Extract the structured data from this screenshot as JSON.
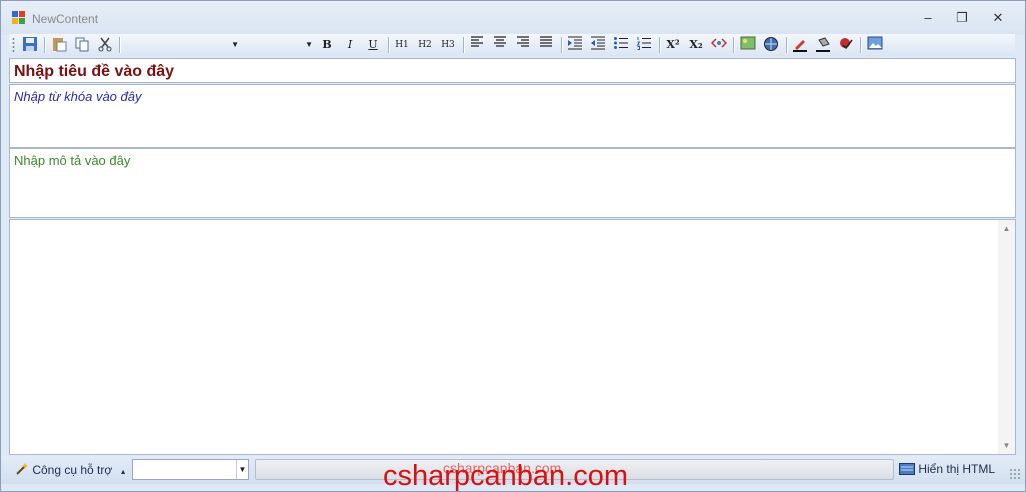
{
  "window": {
    "title": "NewContent",
    "minimize": "–",
    "maximize": "❐",
    "close": "✕"
  },
  "toolbar": {
    "bold": "B",
    "italic": "I",
    "underline": "U",
    "h1": "H1",
    "h2": "H2",
    "h3": "H3",
    "superscript": "X²",
    "subscript": "X₂",
    "font_family": "",
    "font_size": ""
  },
  "fields": {
    "title_placeholder": "Nhập tiêu đề vào đây",
    "keywords_placeholder": "Nhập từ khóa vào đây",
    "description_placeholder": "Nhập mô tả vào đây"
  },
  "statusbar": {
    "tools_label": "Công cụ hỗ trợ",
    "tools_combo_value": "",
    "html_button": "Hiển thị HTML"
  },
  "watermark": {
    "small": "csharpcanban.com",
    "big": "csharpcanban.com"
  },
  "colors": {
    "title_text": "#7a1010",
    "keywords_text": "#2a2aa8",
    "description_text": "#3a8a2a",
    "watermark": "#d81010"
  }
}
